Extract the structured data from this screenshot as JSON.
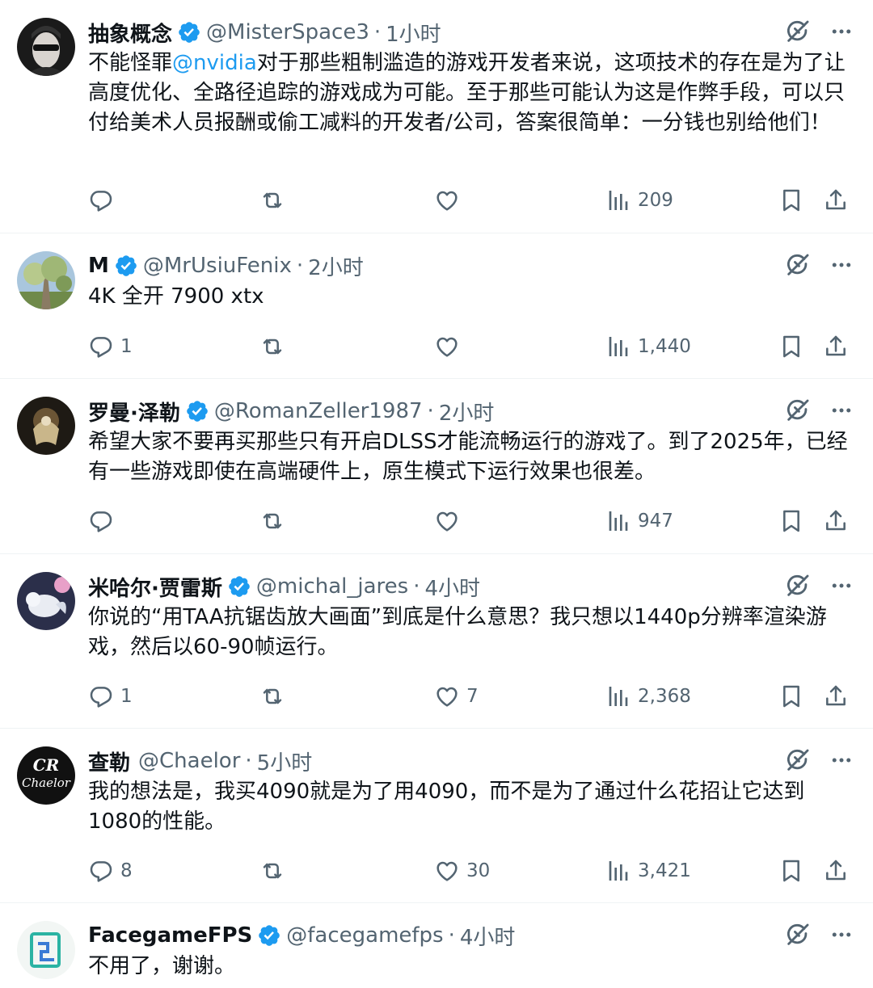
{
  "colors": {
    "accent": "#1d9bf0",
    "muted": "#536471",
    "text": "#0f1419",
    "verified": "#1d9bf0"
  },
  "icons": {
    "reply": "speech-bubble-icon",
    "retweet": "retweet-arrows-icon",
    "like": "heart-icon",
    "views": "bar-chart-icon",
    "bookmark": "bookmark-icon",
    "share": "upload-share-icon",
    "grok": "grok-slash-circle-icon",
    "more": "three-dots-icon",
    "verified": "verified-badge-icon"
  },
  "tweets": [
    {
      "name": "抽象概念",
      "verified": true,
      "handle": "@MisterSpace3",
      "sep": "·",
      "time": "1小时",
      "text_pre": "不能怪罪",
      "mention": "@nvidia",
      "text_post": "对于那些粗制滥造的游戏开发者来说，这项技术的存在是为了让高度优化、全路径追踪的游戏成为可能。至于那些可能认为这是作弊手段，可以只付给美术人员报酬或偷工减料的开发者/公司，答案很简单：一分钱也别给他们！",
      "replies": "",
      "retweets": "",
      "likes": "",
      "views": "209"
    },
    {
      "name": "M",
      "verified": true,
      "handle": "@MrUsiuFenix",
      "sep": "·",
      "time": "2小时",
      "text": "4K 全开 7900 xtx",
      "replies": "1",
      "retweets": "",
      "likes": "",
      "views": "1,440"
    },
    {
      "name": "罗曼·泽勒",
      "verified": true,
      "handle": "@RomanZeller1987",
      "sep": "·",
      "time": "2小时",
      "text": "希望大家不要再买那些只有开启DLSS才能流畅运行的游戏了。到了2025年，已经有一些游戏即使在高端硬件上，原生模式下运行效果也很差。",
      "replies": "",
      "retweets": "",
      "likes": "",
      "views": "947"
    },
    {
      "name": "米哈尔·贾雷斯",
      "verified": true,
      "handle": "@michal_jares",
      "sep": "·",
      "time": "4小时",
      "text": "你说的“用TAA抗锯齿放大画面”到底是什么意思？我只想以1440p分辨率渲染游戏，然后以60-90帧运行。",
      "replies": "1",
      "retweets": "",
      "likes": "7",
      "views": "2,368"
    },
    {
      "name": "查勒",
      "verified": false,
      "handle": "@Chaelor",
      "sep": "·",
      "time": "5小时",
      "text": "我的想法是，我买4090就是为了用4090，而不是为了通过什么花招让它达到1080的性能。",
      "replies": "8",
      "retweets": "",
      "likes": "30",
      "views": "3,421"
    },
    {
      "name": "FacegameFPS",
      "verified": true,
      "handle": "@facegamefps",
      "sep": "·",
      "time": "4小时",
      "text": "不用了，谢谢。",
      "replies": "",
      "retweets": "",
      "likes": "",
      "views": ""
    }
  ]
}
